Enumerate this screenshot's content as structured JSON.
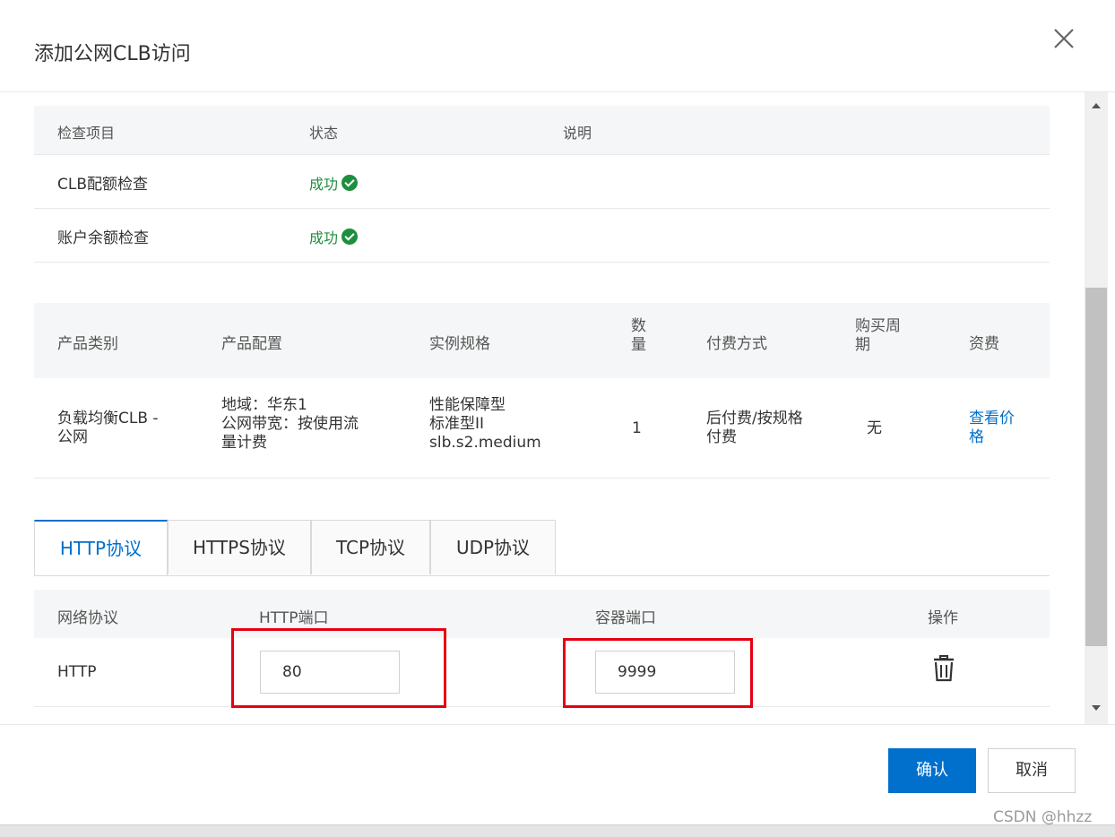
{
  "dialog": {
    "title": "添加公网CLB访问",
    "close_glyph": "×"
  },
  "check_table": {
    "headers": [
      "检查项目",
      "状态",
      "说明"
    ],
    "rows": [
      {
        "item": "CLB配额检查",
        "status": "成功",
        "note": ""
      },
      {
        "item": "账户余额检查",
        "status": "成功",
        "note": ""
      }
    ]
  },
  "product_table": {
    "headers": {
      "category": "产品类别",
      "config": "产品配置",
      "spec": "实例规格",
      "qty": "数\n量",
      "billing": "付费方式",
      "period": "购买周\n期",
      "price": "资费"
    },
    "row": {
      "category": "负载均衡CLB -\n公网",
      "config": "地域：华东1\n公网带宽：按使用流\n量计费",
      "spec": "性能保障型\n标准型II\nslb.s2.medium",
      "qty": "1",
      "billing": "后付费/按规格\n付费",
      "period": "无",
      "price_link": "查看价\n格"
    }
  },
  "tabs": [
    {
      "label": "HTTP协议",
      "active": true
    },
    {
      "label": "HTTPS协议",
      "active": false
    },
    {
      "label": "TCP协议",
      "active": false
    },
    {
      "label": "UDP协议",
      "active": false
    }
  ],
  "port_table": {
    "headers": {
      "protocol": "网络协议",
      "http_port": "HTTP端口",
      "container_port": "容器端口",
      "action": "操作"
    },
    "row": {
      "protocol": "HTTP",
      "http_port": "80",
      "container_port": "9999"
    }
  },
  "footer": {
    "confirm": "确认",
    "cancel": "取消"
  },
  "watermark": "CSDN @hhzz",
  "colors": {
    "primary": "#0070cc",
    "success": "#1e8e3e",
    "highlight": "#e60012"
  },
  "icons": {
    "close": "close-icon",
    "status": "check-circle-icon",
    "delete": "trash-icon"
  }
}
